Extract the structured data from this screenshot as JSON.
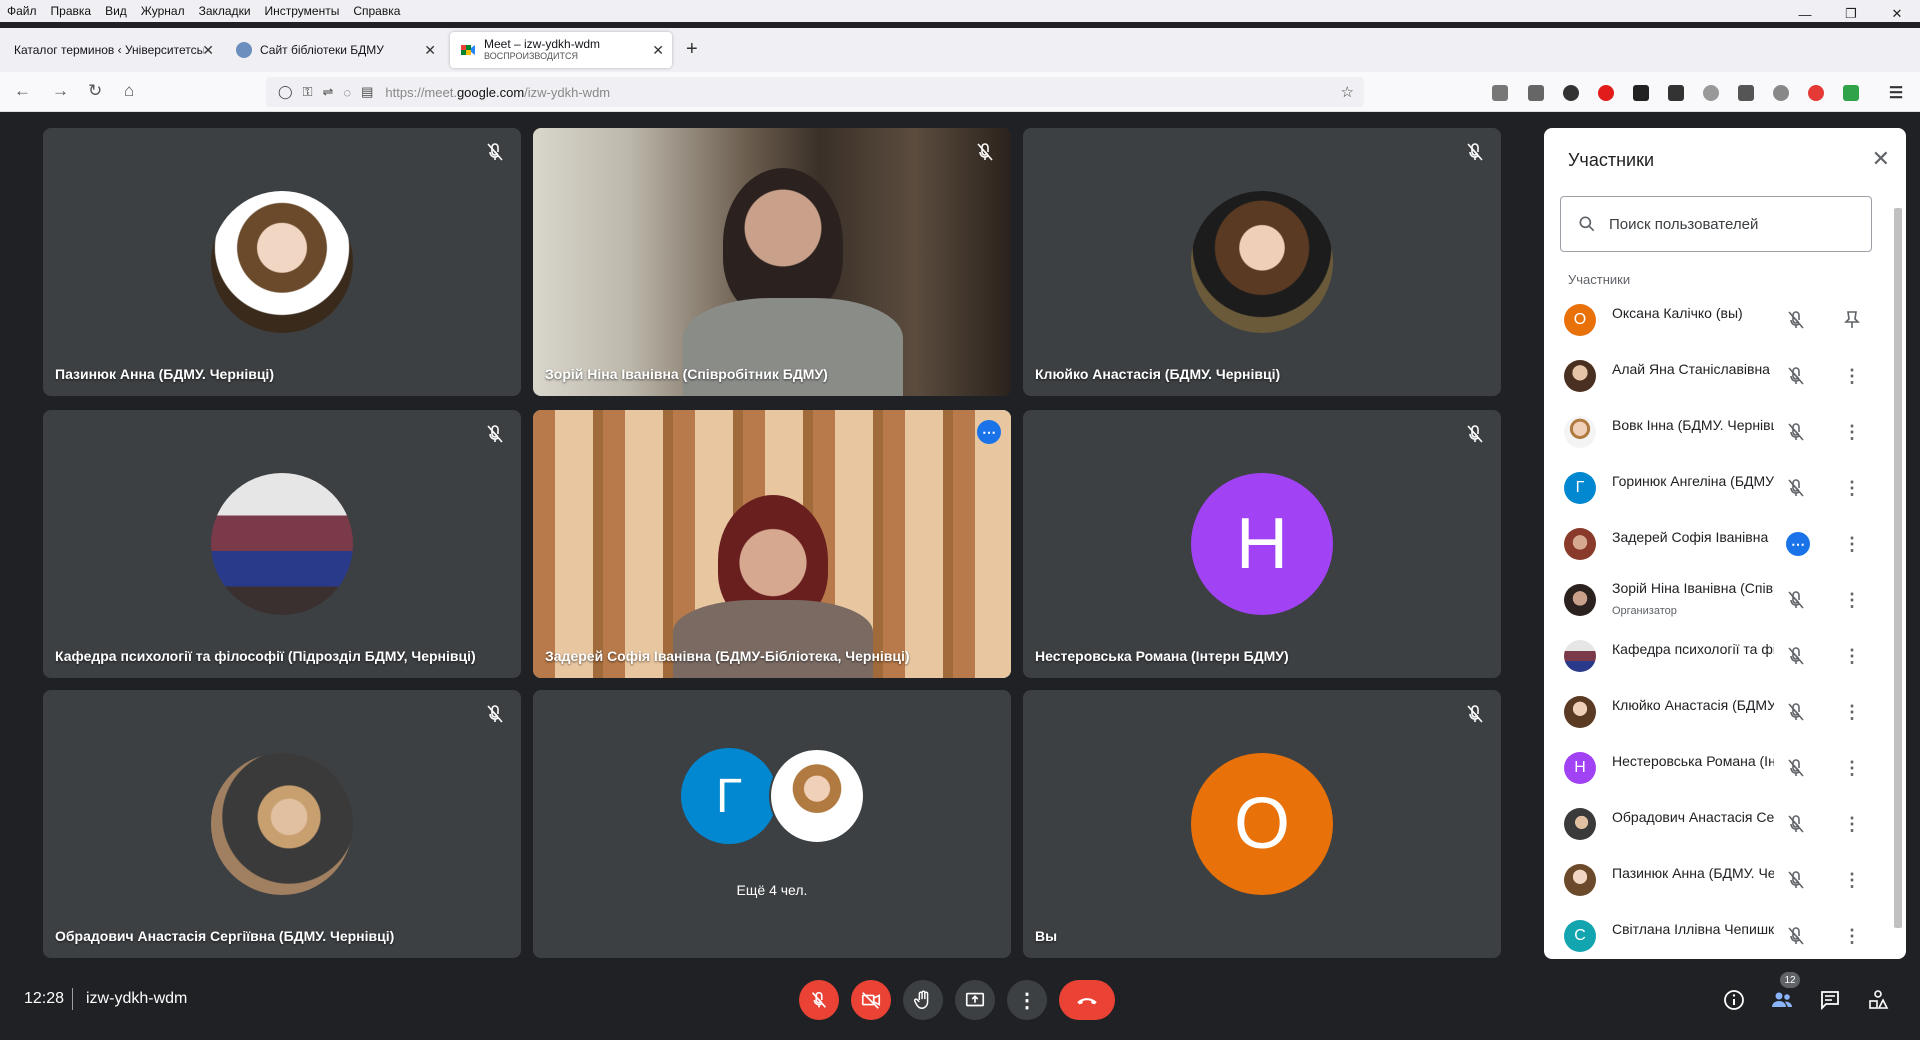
{
  "menubar": [
    "Файл",
    "Правка",
    "Вид",
    "Журнал",
    "Закладки",
    "Инструменты",
    "Справка"
  ],
  "tabs": [
    {
      "title": "Каталог терминов ‹ Університетська"
    },
    {
      "title": "Сайт бібліотеки БДМУ"
    },
    {
      "title": "Meet – izw-ydkh-wdm",
      "subtitle": "ВОСПРОИЗВОДИТСЯ"
    }
  ],
  "url": {
    "prefix": "https://meet.",
    "domain": "google.com",
    "path": "/izw-ydkh-wdm"
  },
  "tiles": [
    {
      "name": "Пазинюк Анна (БДМУ. Чернівці)"
    },
    {
      "name": "Зорій Ніна Іванівна (Співробітник БДМУ)"
    },
    {
      "name": "Клюйко Анастасія (БДМУ. Чернівці)"
    },
    {
      "name": "Кафедра психології та філософії (Підрозділ БДМУ, Чернівці)"
    },
    {
      "name": "Задерей Софія Іванівна (БДМУ-Бібліотека, Чернівці)"
    },
    {
      "name": "Нестеровська Романа (Інтерн БДМУ)",
      "letter": "Н"
    },
    {
      "name": "Обрадович Анастасія Сергіївна (БДМУ. Чернівці)"
    },
    {
      "more": "Ещё 4 чел.",
      "letter": "Г"
    },
    {
      "name": "Вы",
      "letter": "О"
    }
  ],
  "panel": {
    "title": "Участники",
    "search_placeholder": "Поиск пользователей",
    "section": "Участники",
    "participants": [
      {
        "name": "Оксана Калічко (вы)",
        "letter": "О",
        "color": "#e8710a"
      },
      {
        "name": "Алай Яна Станіславівна"
      },
      {
        "name": "Вовк Інна (БДМУ. Чернівці)"
      },
      {
        "name": "Горинюк Ангеліна (БДМУ)",
        "letter": "Г",
        "color": "#1a73e8"
      },
      {
        "name": "Задерей Софія Іванівна"
      },
      {
        "name": "Зорій Ніна Іванівна (Співробітник БДМУ)",
        "role": "Организатор"
      },
      {
        "name": "Кафедра психології та філософії"
      },
      {
        "name": "Клюйко Анастасія (БДМУ)"
      },
      {
        "name": "Нестеровська Романа (Інтерн БДМУ)",
        "letter": "Н",
        "color": "#a142f4"
      },
      {
        "name": "Обрадович Анастасія Сергіївна"
      },
      {
        "name": "Пазинюк Анна (БДМУ. Чернівці)"
      },
      {
        "name": "Світлана Іллівна Чепишко",
        "letter": "С",
        "color": "#12a4af"
      }
    ]
  },
  "bottom": {
    "time": "12:28",
    "code": "izw-ydkh-wdm",
    "people_count": "12"
  }
}
